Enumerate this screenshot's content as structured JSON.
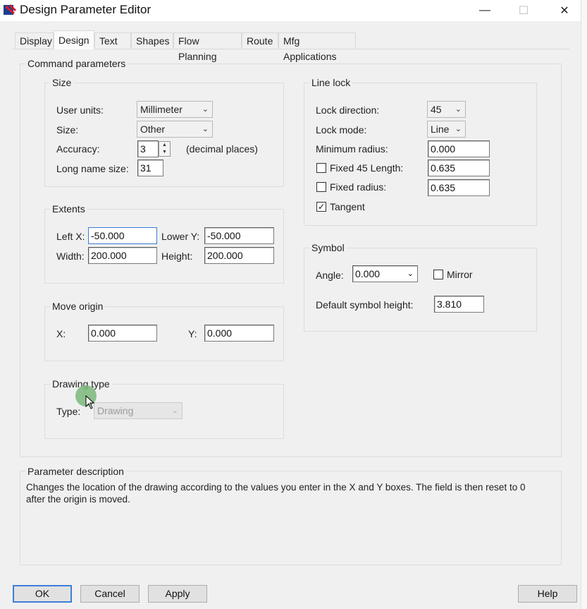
{
  "window": {
    "title": "Design Parameter Editor",
    "min_glyph": "—",
    "max_glyph": "☐",
    "close_glyph": "✕"
  },
  "tabs": [
    "Display",
    "Design",
    "Text",
    "Shapes",
    "Flow Planning",
    "Route",
    "Mfg Applications"
  ],
  "active_tab": "Design",
  "command_parameters": {
    "title": "Command parameters",
    "size": {
      "title": "Size",
      "user_units_label": "User units:",
      "user_units_value": "Millimeter",
      "size_label": "Size:",
      "size_value": "Other",
      "accuracy_label": "Accuracy:",
      "accuracy_value": "3",
      "accuracy_suffix": "(decimal places)",
      "long_name_label": "Long name size:",
      "long_name_value": "31"
    },
    "extents": {
      "title": "Extents",
      "left_x_label": "Left X:",
      "left_x_value": "-50.000",
      "lower_y_label": "Lower Y:",
      "lower_y_value": "-50.000",
      "width_label": "Width:",
      "width_value": "200.000",
      "height_label": "Height:",
      "height_value": "200.000"
    },
    "move_origin": {
      "title": "Move origin",
      "x_label": "X:",
      "x_value": "0.000",
      "y_label": "Y:",
      "y_value": "0.000"
    },
    "drawing_type": {
      "title": "Drawing type",
      "type_label": "Type:",
      "type_value": "Drawing"
    },
    "line_lock": {
      "title": "Line lock",
      "lock_direction_label": "Lock direction:",
      "lock_direction_value": "45",
      "lock_mode_label": "Lock mode:",
      "lock_mode_value": "Line",
      "min_radius_label": "Minimum radius:",
      "min_radius_value": "0.000",
      "fixed45_label": "Fixed 45 Length:",
      "fixed45_checked": false,
      "fixed45_value": "0.635",
      "fixed_radius_label": "Fixed radius:",
      "fixed_radius_checked": false,
      "fixed_radius_value": "0.635",
      "tangent_label": "Tangent",
      "tangent_checked": true
    },
    "symbol": {
      "title": "Symbol",
      "angle_label": "Angle:",
      "angle_value": "0.000",
      "mirror_label": "Mirror",
      "mirror_checked": false,
      "default_height_label": "Default symbol height:",
      "default_height_value": "3.810"
    }
  },
  "parameter_description": {
    "title": "Parameter description",
    "text": "Changes the location of the drawing according to the values you enter in the X and Y boxes. The field is then reset to 0 after the origin is moved."
  },
  "buttons": {
    "ok": "OK",
    "cancel": "Cancel",
    "apply": "Apply",
    "help": "Help"
  },
  "icons": {
    "chevron": "⌄",
    "check": "✓",
    "spin_up": "▲",
    "spin_down": "▼"
  }
}
